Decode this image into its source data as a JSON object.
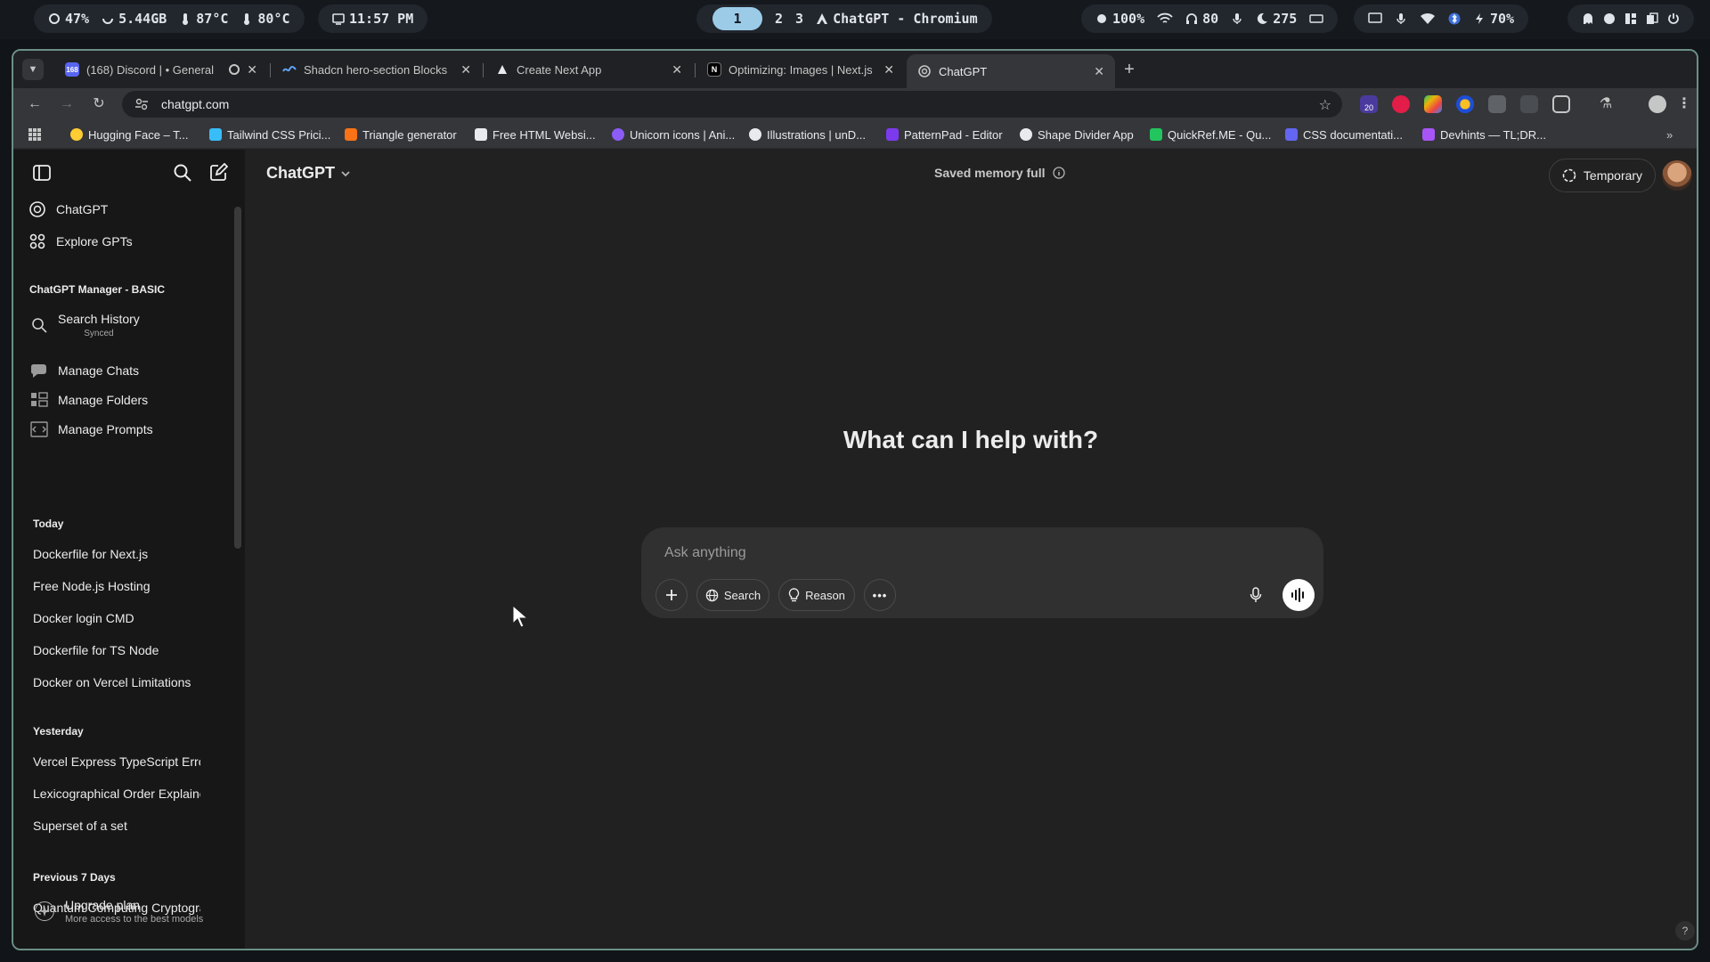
{
  "sysbar": {
    "cpu": "47%",
    "mem": "5.44GB",
    "temp1": "87°C",
    "temp2": "80°C",
    "time": "11:57 PM",
    "workspaces": [
      "1",
      "2",
      "3"
    ],
    "window_title": "ChatGPT - Chromium",
    "brightness": "100%",
    "headphones": "80",
    "mic": "275",
    "battery": "70%"
  },
  "browser": {
    "tabs": [
      {
        "title": "(168) Discord | • General",
        "badge": "168",
        "color": "#5865f2"
      },
      {
        "title": "Shadcn hero-section Blocks",
        "color": "#3b82f6"
      },
      {
        "title": "Create Next App",
        "color": "#e8eaed"
      },
      {
        "title": "Optimizing: Images | Next.js",
        "color": "#e8eaed"
      },
      {
        "title": "ChatGPT",
        "color": "#c4c7c5"
      }
    ],
    "url": "chatgpt.com",
    "extension_badge": "20",
    "bookmarks": [
      {
        "label": "Hugging Face – T...",
        "color": "#ffcc33"
      },
      {
        "label": "Tailwind CSS Prici...",
        "color": "#38bdf8"
      },
      {
        "label": "Triangle generator",
        "color": "#f97316"
      },
      {
        "label": "Free HTML Websi...",
        "color": "#e8eaed"
      },
      {
        "label": "Unicorn icons | Ani...",
        "color": "#8b5cf6"
      },
      {
        "label": "Illustrations | unD...",
        "color": "#e8eaed"
      },
      {
        "label": "PatternPad - Editor",
        "color": "#7c3aed"
      },
      {
        "label": "Shape Divider App",
        "color": "#e8eaed"
      },
      {
        "label": "QuickRef.ME - Qu...",
        "color": "#22c55e"
      },
      {
        "label": "CSS documentati...",
        "color": "#6366f1"
      },
      {
        "label": "Devhints — TL;DR...",
        "color": "#a855f7"
      }
    ]
  },
  "sidebar": {
    "top_items": [
      {
        "label": "ChatGPT",
        "icon": "openai-logo-icon"
      },
      {
        "label": "Explore GPTs",
        "icon": "grid-icon"
      }
    ],
    "manager_title": "ChatGPT Manager - BASIC",
    "manager_items": [
      {
        "label": "Search History",
        "sub": "Synced",
        "icon": "search-icon"
      },
      {
        "label": "Manage Chats",
        "icon": "chat-bubble-icon"
      },
      {
        "label": "Manage Folders",
        "icon": "folders-icon"
      },
      {
        "label": "Manage Prompts",
        "icon": "prompt-icon"
      }
    ],
    "sections": [
      {
        "title": "Today",
        "items": [
          "Dockerfile for Next.js",
          "Free Node.js Hosting",
          "Docker login CMD",
          "Dockerfile for TS Node",
          "Docker on Vercel Limitations"
        ]
      },
      {
        "title": "Yesterday",
        "items": [
          "Vercel Express TypeScript Error",
          "Lexicographical Order Explained",
          "Superset of a set"
        ]
      },
      {
        "title": "Previous 7 Days",
        "items": [
          "Quantum Computing Cryptography"
        ]
      }
    ],
    "upgrade": {
      "title": "Upgrade plan",
      "sub": "More access to the best models"
    }
  },
  "main": {
    "model": "ChatGPT",
    "memory_notice": "Saved memory full",
    "temporary_label": "Temporary",
    "headline": "What can I help with?",
    "composer": {
      "placeholder": "Ask anything",
      "search_label": "Search",
      "reason_label": "Reason"
    },
    "help": "?"
  }
}
